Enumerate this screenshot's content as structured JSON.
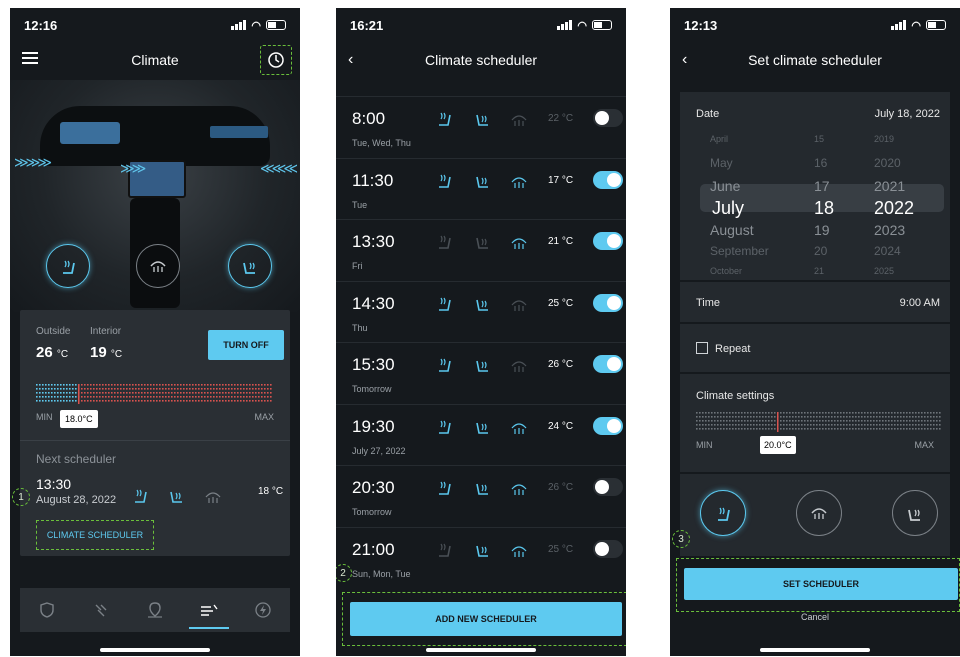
{
  "colors": {
    "accent": "#5ecaf0",
    "annotation": "#6abf3b",
    "background": "#15191d",
    "panel": "#2a2f34",
    "heat": "#d9534f"
  },
  "screen1": {
    "status_time": "12:16",
    "title": "Climate",
    "outside_label": "Outside",
    "interior_label": "Interior",
    "outside_temp": "26",
    "interior_temp": "19",
    "unit": "°C",
    "turn_off_label": "TURN OFF",
    "min_label": "MIN",
    "max_label": "MAX",
    "temp_marker": "18.0°C",
    "temp_level": 0.18,
    "next_scheduler_label": "Next scheduler",
    "next_time": "13:30",
    "next_date": "August 28, 2022",
    "next_temp": "18 °C",
    "climate_scheduler_link": "CLIMATE SCHEDULER",
    "annotation": "1",
    "tabs": [
      "shield-icon",
      "plug-icon",
      "map-pin-icon",
      "climate-icon",
      "bolt-icon"
    ],
    "active_tab": 3
  },
  "screen2": {
    "status_time": "16:21",
    "title": "Climate scheduler",
    "annotation": "2",
    "add_button": "ADD NEW SCHEDULER",
    "rows": [
      {
        "time": "8:00",
        "days": "Tue, Wed, Thu",
        "temp": "22 °C",
        "on": false,
        "icons": [
          true,
          true,
          false
        ]
      },
      {
        "time": "11:30",
        "days": "Tue",
        "temp": "17 °C",
        "on": true,
        "icons": [
          true,
          true,
          true
        ]
      },
      {
        "time": "13:30",
        "days": "Fri",
        "temp": "21 °C",
        "on": true,
        "icons": [
          false,
          false,
          true
        ]
      },
      {
        "time": "14:30",
        "days": "Thu",
        "temp": "25 °C",
        "on": true,
        "icons": [
          true,
          true,
          false
        ]
      },
      {
        "time": "15:30",
        "days": "Tomorrow",
        "temp": "26 °C",
        "on": true,
        "icons": [
          true,
          true,
          false
        ]
      },
      {
        "time": "19:30",
        "days": "July 27, 2022",
        "temp": "24 °C",
        "on": true,
        "icons": [
          true,
          true,
          true
        ]
      },
      {
        "time": "20:30",
        "days": "Tomorrow",
        "temp": "26 °C",
        "on": false,
        "icons": [
          true,
          true,
          true
        ]
      },
      {
        "time": "21:00",
        "days": "Sun, Mon, Tue",
        "temp": "25 °C",
        "on": false,
        "icons": [
          false,
          true,
          true
        ]
      }
    ]
  },
  "screen3": {
    "status_time": "12:13",
    "title": "Set climate scheduler",
    "date_label": "Date",
    "date_value": "July 18, 2022",
    "picker": {
      "months": [
        "April",
        "May",
        "June",
        "July",
        "August",
        "September",
        "October"
      ],
      "days": [
        "15",
        "16",
        "17",
        "18",
        "19",
        "20",
        "21"
      ],
      "years": [
        "2019",
        "2020",
        "2021",
        "2022",
        "2023",
        "2024",
        "2025"
      ],
      "selected_index": 3
    },
    "time_label": "Time",
    "time_value": "9:00 AM",
    "repeat_label": "Repeat",
    "climate_settings_label": "Climate settings",
    "min_label": "MIN",
    "max_label": "MAX",
    "temp_marker": "20.0°C",
    "temp_level": 0.33,
    "annotation": "3",
    "set_button": "SET SCHEDULER",
    "cancel_label": "Cancel"
  }
}
